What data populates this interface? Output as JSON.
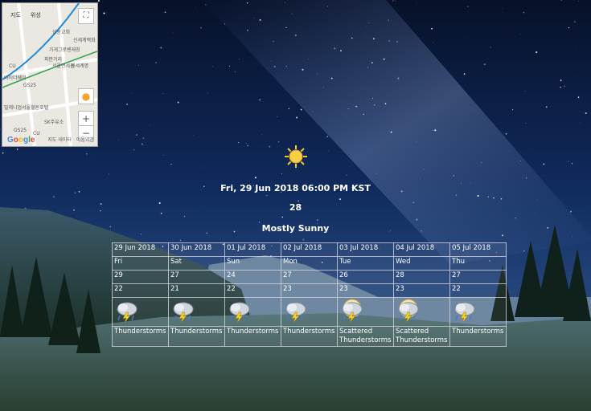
{
  "map": {
    "tabs": [
      "지도",
      "위성"
    ],
    "labels": [
      "상동교회",
      "신세계백화",
      "가게그로벤래칭",
      "피판거리",
      "서울면세점",
      "신세계명",
      "바이더웨이",
      "GS25",
      "CU",
      "밀레니엄서울힐튼호텔",
      "SK주유소",
      "GS25",
      "CU"
    ],
    "zoom_in": "+",
    "zoom_out": "−",
    "fullscreen": "⛶",
    "google": "Google",
    "footer": [
      "지도 데이터",
      "이용약관"
    ]
  },
  "current": {
    "icon": "sun-icon",
    "datetime": "Fri, 29 Jun 2018 06:00 PM KST",
    "temperature": "28",
    "condition": "Mostly Sunny"
  },
  "forecast": [
    {
      "date": "29 Jun 2018",
      "day": "Fri",
      "high": "29",
      "low": "22",
      "icon": "thunderstorm-icon",
      "text": "Thunderstorms"
    },
    {
      "date": "30 Jun 2018",
      "day": "Sat",
      "high": "27",
      "low": "21",
      "icon": "thunderstorm-icon",
      "text": "Thunderstorms"
    },
    {
      "date": "01 Jul 2018",
      "day": "Sun",
      "high": "24",
      "low": "22",
      "icon": "thunderstorm-icon",
      "text": "Thunderstorms"
    },
    {
      "date": "02 Jul 2018",
      "day": "Mon",
      "high": "27",
      "low": "23",
      "icon": "thunderstorm-icon",
      "text": "Thunderstorms"
    },
    {
      "date": "03 Jul 2018",
      "day": "Tue",
      "high": "26",
      "low": "23",
      "icon": "scattered-thunderstorm-icon",
      "text": "Scattered Thunderstorms"
    },
    {
      "date": "04 Jul 2018",
      "day": "Wed",
      "high": "28",
      "low": "23",
      "icon": "scattered-thunderstorm-icon",
      "text": "Scattered Thunderstorms"
    },
    {
      "date": "05 Jul 2018",
      "day": "Thu",
      "high": "27",
      "low": "22",
      "icon": "thunderstorm-icon",
      "text": "Thunderstorms"
    }
  ]
}
